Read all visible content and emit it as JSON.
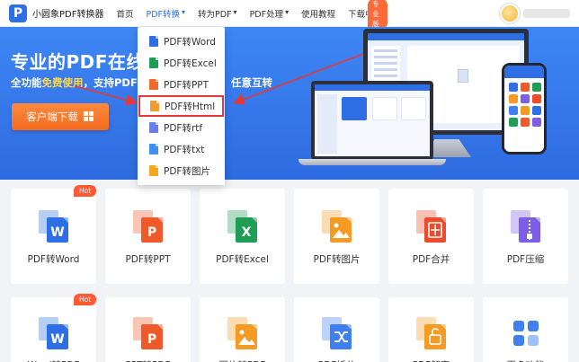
{
  "header": {
    "logo_letter": "P",
    "logo_text": "小圆象PDF转换器",
    "nav": [
      {
        "label": "首页",
        "active": false
      },
      {
        "label": "PDF转换",
        "active": true,
        "caret": "▾"
      },
      {
        "label": "转为PDF",
        "active": false,
        "caret": "▾"
      },
      {
        "label": "PDF处理",
        "active": false,
        "caret": "▾"
      },
      {
        "label": "使用教程",
        "active": false
      },
      {
        "label": "下载中心",
        "active": false,
        "caret": "▾",
        "badge": "专业版"
      }
    ]
  },
  "hero": {
    "title": "专业的PDF在线转",
    "subtitle_prefix": "全功能",
    "subtitle_free": "免费使用",
    "subtitle_middle": "，支持PDF",
    "subtitle_right": "任意互转",
    "download_label": "客户端下载",
    "title_right": "任"
  },
  "dropdown": {
    "items": [
      {
        "label": "PDF转Word",
        "color": "#2f6fe6",
        "highlight": false
      },
      {
        "label": "PDF转Excel",
        "color": "#1f9d55",
        "highlight": false
      },
      {
        "label": "PDF转PPT",
        "color": "#f06a2a",
        "highlight": false
      },
      {
        "label": "PDF转Html",
        "color": "#f29a2e",
        "highlight": true
      },
      {
        "label": "PDF转rtf",
        "color": "#6a7de8",
        "highlight": false
      },
      {
        "label": "PDF转txt",
        "color": "#3f8ef0",
        "highlight": false
      },
      {
        "label": "PDF转图片",
        "color": "#f5a623",
        "highlight": false
      }
    ]
  },
  "tools_row1": [
    {
      "label": "PDF转Word",
      "hot": "Hot",
      "icon": "word-icon",
      "color": "#2f6fe6",
      "letter": "W"
    },
    {
      "label": "PDF转PPT",
      "hot": "",
      "icon": "ppt-icon",
      "color": "#f0592a",
      "letter": "P"
    },
    {
      "label": "PDF转Excel",
      "hot": "",
      "icon": "excel-icon",
      "color": "#1f9d55",
      "letter": "X"
    },
    {
      "label": "PDF转图片",
      "hot": "",
      "icon": "image-icon",
      "color": "#f59a23",
      "letter": ""
    },
    {
      "label": "PDF合并",
      "hot": "",
      "icon": "merge-icon",
      "color": "#f04a2a",
      "letter": ""
    },
    {
      "label": "PDF压缩",
      "hot": "",
      "icon": "compress-icon",
      "color": "#7d5ce6",
      "letter": ""
    }
  ],
  "tools_row2": [
    {
      "label": "Word转PDF",
      "hot": "Hot",
      "icon": "word-to-pdf-icon",
      "color": "#2f6fe6",
      "letter": "W"
    },
    {
      "label": "PPT转PDF",
      "hot": "",
      "icon": "ppt-to-pdf-icon",
      "color": "#f0592a",
      "letter": "P"
    },
    {
      "label": "图片转PDF",
      "hot": "",
      "icon": "image-to-pdf-icon",
      "color": "#f59a23",
      "letter": ""
    },
    {
      "label": "PDF拆分",
      "hot": "",
      "icon": "split-icon",
      "color": "#3f7ff0",
      "letter": ""
    },
    {
      "label": "PDF解密",
      "hot": "",
      "icon": "unlock-icon",
      "color": "#f59a23",
      "letter": ""
    },
    {
      "label": "更多功能",
      "hot": "",
      "icon": "more-icon",
      "color": "#3f7ff0",
      "letter": ""
    }
  ]
}
